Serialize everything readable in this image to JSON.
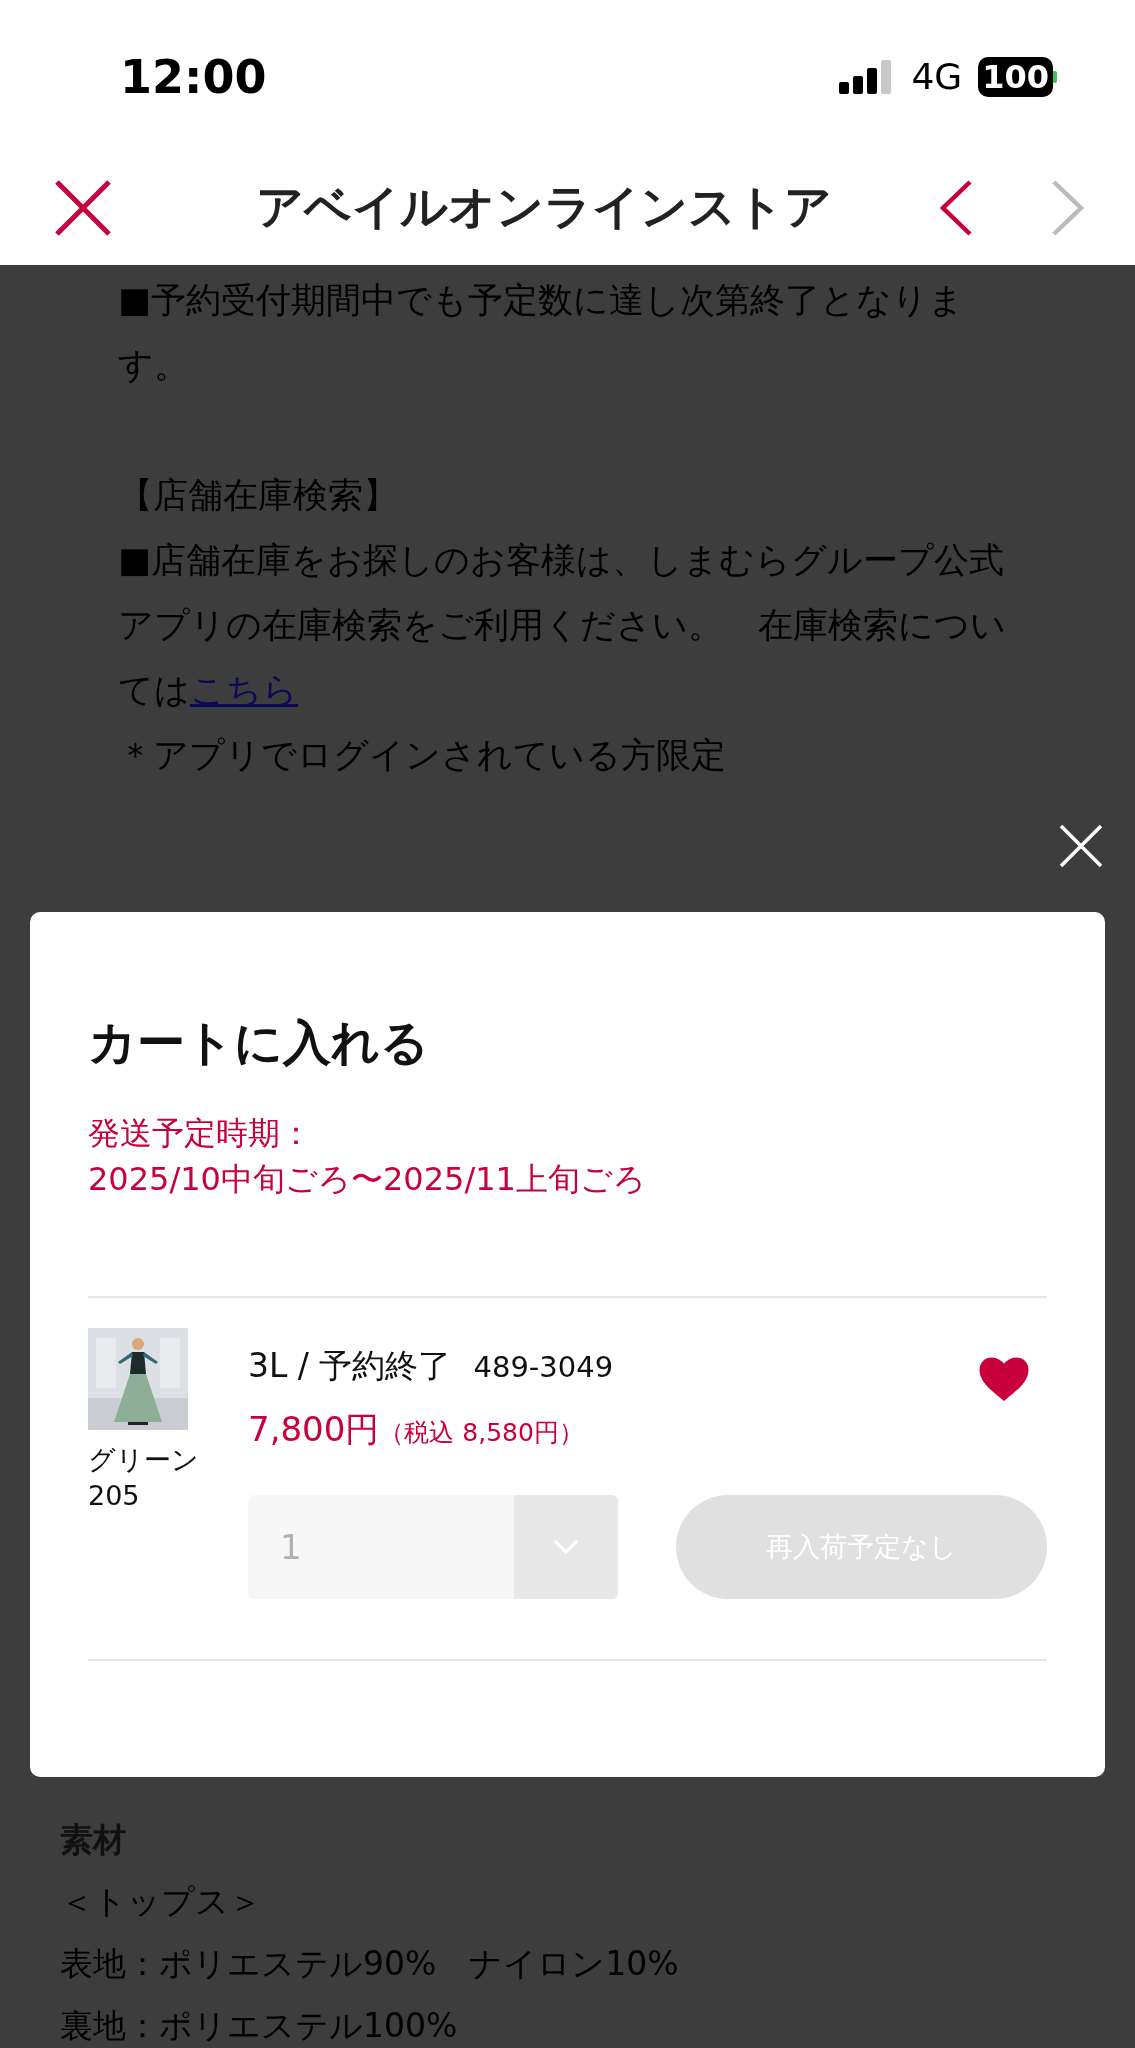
{
  "status_bar": {
    "time": "12:00",
    "network": "4G",
    "battery": "100"
  },
  "header": {
    "title": "アベイルオンラインストア",
    "back_enabled": true,
    "forward_enabled": false
  },
  "background": {
    "notice": "■予約受付期間中でも予定数に達し次第終了となります。",
    "store_stock_heading": "【店舗在庫検索】",
    "store_stock_text": "■店舗在庫をお探しのお客様は、しまむらグループ公式アプリの在庫検索をご利用ください。　在庫検索については",
    "store_stock_link": "こちら",
    "note": "＊アプリでログインされている方限定"
  },
  "modal": {
    "title": "カートに入れる",
    "shipping_label": "発送予定時期：",
    "shipping_period": "2025/10中旬ごろ〜2025/11上旬ごろ",
    "item": {
      "color_name": "グリーン",
      "color_code": "205",
      "size_status": "3L / 予約終了",
      "product_code": "489-3049",
      "price": "7,800円",
      "price_with_tax": "（税込 8,580円）",
      "favorite": true,
      "quantity": "1",
      "quantity_disabled": true,
      "button": "再入荷予定なし",
      "button_disabled": true
    }
  },
  "material": {
    "heading": "素材",
    "lines": [
      "＜トップス＞",
      "表地：ポリエステル90%　ナイロン10%",
      "裏地：ポリエステル100%"
    ]
  }
}
